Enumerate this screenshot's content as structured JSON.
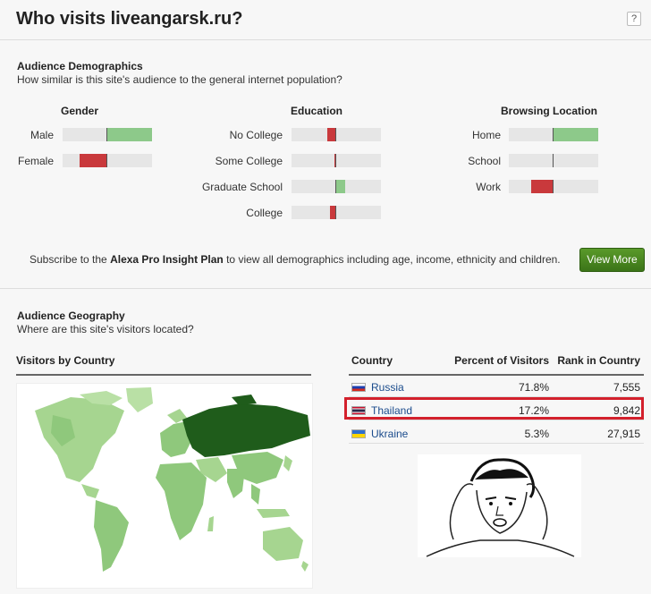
{
  "header": {
    "title": "Who visits liveangarsk.ru?",
    "help": "?"
  },
  "demographics": {
    "title": "Audience Demographics",
    "subtitle": "How similar is this site's audience to the general internet population?",
    "gender": {
      "label": "Gender",
      "rows": [
        {
          "label": "Male",
          "value": 1.0
        },
        {
          "label": "Female",
          "value": -0.62
        }
      ]
    },
    "education": {
      "label": "Education",
      "rows": [
        {
          "label": "No College",
          "value": -0.2
        },
        {
          "label": "Some College",
          "value": -0.05
        },
        {
          "label": "Graduate School",
          "value": 0.2
        },
        {
          "label": "College",
          "value": -0.15
        }
      ]
    },
    "location": {
      "label": "Browsing Location",
      "rows": [
        {
          "label": "Home",
          "value": 1.0
        },
        {
          "label": "School",
          "value": 0
        },
        {
          "label": "Work",
          "value": -0.5
        }
      ]
    },
    "subscribe_pre": "Subscribe to the ",
    "subscribe_bold": "Alexa Pro Insight Plan",
    "subscribe_post": " to view all demographics including age, income, ethnicity and children.",
    "view_more": "View More"
  },
  "geography": {
    "title": "Audience Geography",
    "subtitle": "Where are this site's visitors located?",
    "map_label": "Visitors by Country",
    "table": {
      "headers": [
        "Country",
        "Percent of Visitors",
        "Rank in Country"
      ],
      "rows": [
        {
          "country": "Russia",
          "percent": "71.8%",
          "rank": "7,555"
        },
        {
          "country": "Thailand",
          "percent": "17.2%",
          "rank": "9,842"
        },
        {
          "country": "Ukraine",
          "percent": "5.3%",
          "rank": "27,915"
        }
      ]
    }
  }
}
